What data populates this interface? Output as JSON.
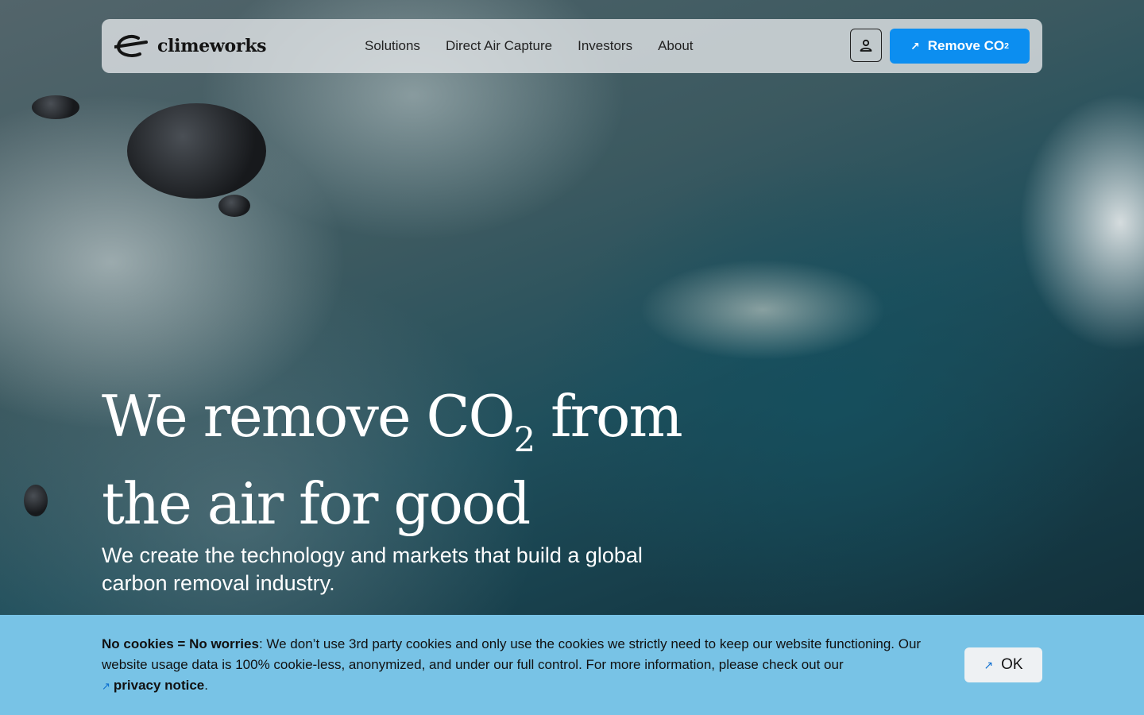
{
  "nav": {
    "logo_text": "climeworks",
    "links": [
      "Solutions",
      "Direct Air Capture",
      "Investors",
      "About"
    ],
    "account_icon": "user-icon",
    "cta": {
      "label": "Remove CO",
      "subscript": "2",
      "icon": "arrow-up-right-icon"
    }
  },
  "hero": {
    "headline_part1": "We remove CO",
    "headline_sub": "2",
    "headline_part2": " from",
    "headline_line2": "the air for good",
    "subheadline": "We create the technology and markets that build a global carbon removal industry."
  },
  "cookie_banner": {
    "bold_lead": "No cookies = No worries",
    "text": ": We don’t use 3rd party cookies and only use the cookies we strictly need to keep our website functioning. Our website usage data is 100% cookie-less, anonymized, and under our full control. For more information, please check out our",
    "link_label": "privacy notice",
    "trailing": ".",
    "ok_label": "OK"
  },
  "colors": {
    "accent_blue": "#0c8ef0",
    "cookie_bg": "#78c3e6"
  }
}
